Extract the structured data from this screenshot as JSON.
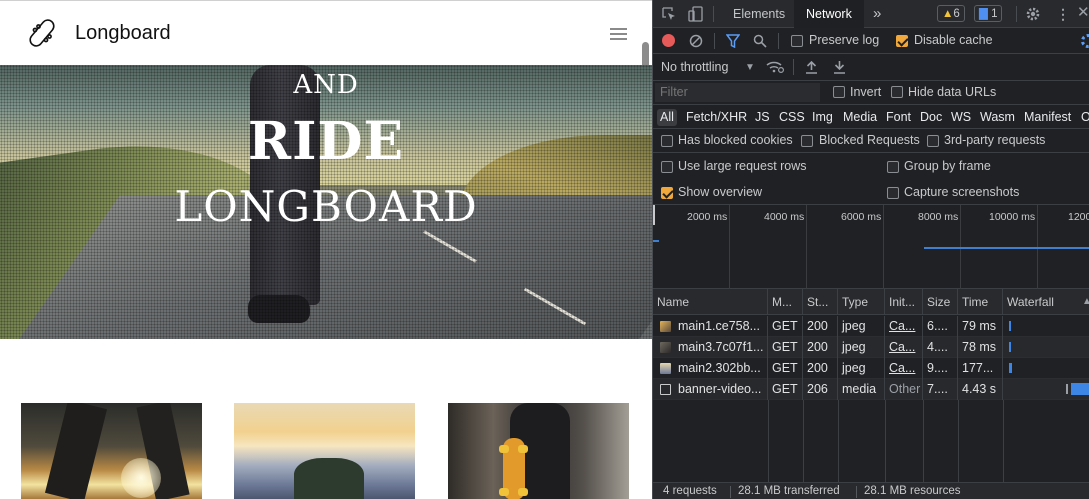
{
  "site": {
    "brand": "Longboard",
    "hero": {
      "line1": "AND",
      "line2": "RIDE",
      "line3": "LONGBOARD"
    }
  },
  "devtools": {
    "tabs": {
      "elements": "Elements",
      "network": "Network",
      "more": "»"
    },
    "badges": {
      "warnings": "6",
      "messages": "1"
    },
    "toolbar": {
      "preserve_log": "Preserve log",
      "disable_cache": "Disable cache",
      "throttling": "No throttling"
    },
    "filter": {
      "placeholder": "Filter",
      "invert": "Invert",
      "hide_data_urls": "Hide data URLs"
    },
    "types": [
      "All",
      "Fetch/XHR",
      "JS",
      "CSS",
      "Img",
      "Media",
      "Font",
      "Doc",
      "WS",
      "Wasm",
      "Manifest",
      "O"
    ],
    "blocked": {
      "has_blocked_cookies": "Has blocked cookies",
      "blocked_requests": "Blocked Requests",
      "third_party": "3rd-party requests"
    },
    "options": {
      "large_rows": "Use large request rows",
      "group_by_frame": "Group by frame",
      "show_overview": "Show overview",
      "capture_screenshots": "Capture screenshots"
    },
    "overview_ticks": [
      "2000 ms",
      "4000 ms",
      "6000 ms",
      "8000 ms",
      "10000 ms",
      "1200"
    ],
    "columns": [
      "Name",
      "M...",
      "St...",
      "Type",
      "Init...",
      "Size",
      "Time",
      "Waterfall"
    ],
    "rows": [
      {
        "name": "main1.ce758...",
        "method": "GET",
        "status": "200",
        "type": "jpeg",
        "initiator": "Ca...",
        "size": "6....",
        "time": "79 ms"
      },
      {
        "name": "main3.7c07f1...",
        "method": "GET",
        "status": "200",
        "type": "jpeg",
        "initiator": "Ca...",
        "size": "4....",
        "time": "78 ms"
      },
      {
        "name": "main2.302bb...",
        "method": "GET",
        "status": "200",
        "type": "jpeg",
        "initiator": "Ca...",
        "size": "9....",
        "time": "177..."
      },
      {
        "name": "banner-video...",
        "method": "GET",
        "status": "206",
        "type": "media",
        "initiator": "Other",
        "size": "7....",
        "time": "4.43 s"
      }
    ],
    "status": {
      "requests": "4 requests",
      "transferred": "28.1 MB transferred",
      "resources": "28.1 MB resources"
    },
    "colors": {
      "accent": "#f0a83d",
      "record": "#e65a5a",
      "link": "#8ab4f8",
      "waterfall": "#3e86e6"
    }
  }
}
